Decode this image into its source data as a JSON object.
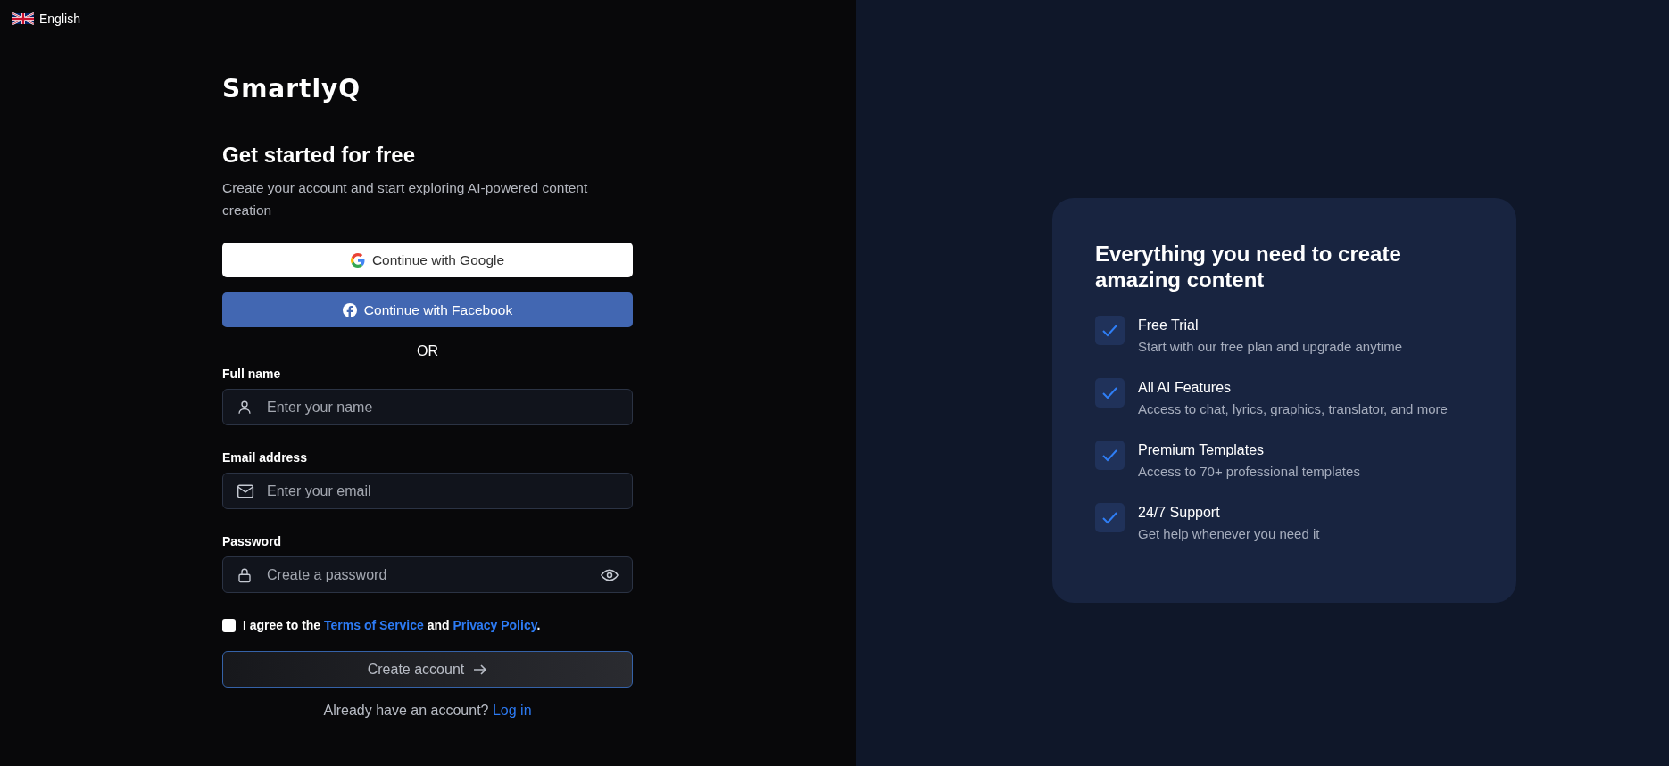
{
  "language": {
    "label": "English"
  },
  "logo": "SmartlyQ",
  "heading": "Get started for free",
  "subtitle": "Create your account and start exploring AI-powered content creation",
  "social_buttons": [
    {
      "kind": "google",
      "label": "Continue with Google"
    },
    {
      "kind": "facebook",
      "label": "Continue with Facebook"
    }
  ],
  "divider": "OR",
  "fields": [
    {
      "kind": "person",
      "label": "Full name",
      "placeholder": "Enter your name"
    },
    {
      "kind": "email",
      "label": "Email address",
      "placeholder": "Enter your email"
    },
    {
      "kind": "password",
      "label": "Password",
      "placeholder": "Create a password"
    }
  ],
  "agreement": {
    "checked": false,
    "prefix": "I agree to the",
    "terms_link": "Terms of Service",
    "middle": "and",
    "privacy_link": "Privacy Policy",
    "suffix": "."
  },
  "submit": {
    "label": "Create account"
  },
  "login_prompt": {
    "text": "Already have an account?",
    "link": "Log in"
  },
  "features_card": {
    "title": "Everything you need to create amazing content",
    "items": [
      {
        "title": "Free Trial",
        "description": "Start with our free plan and upgrade anytime"
      },
      {
        "title": "All AI Features",
        "description": "Access to chat, lyrics, graphics, translator, and more"
      },
      {
        "title": "Premium Templates",
        "description": "Access to 70+ professional templates"
      },
      {
        "title": "24/7 Support",
        "description": "Get help whenever you need it"
      }
    ]
  }
}
